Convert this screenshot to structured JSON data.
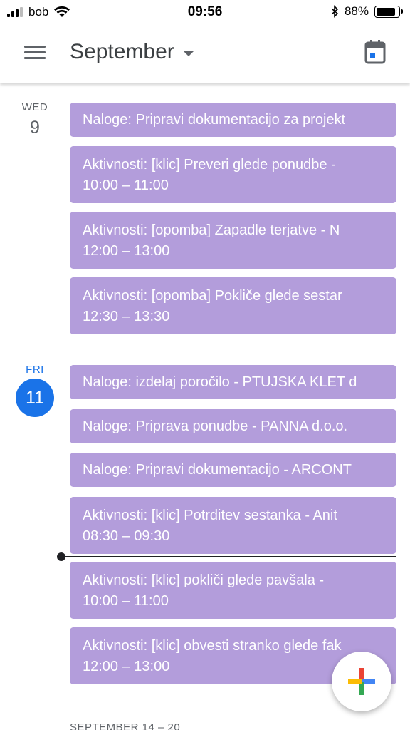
{
  "status_bar": {
    "carrier": "bob",
    "time": "09:56",
    "battery": "88%",
    "battery_level": 0.88,
    "icons": [
      "signal-icon",
      "wifi-icon",
      "bluetooth-icon",
      "battery-icon"
    ]
  },
  "header": {
    "month": "September",
    "menu_icon": "menu-icon",
    "dropdown_icon": "chevron-down-icon",
    "today_icon": "calendar-today-icon"
  },
  "colors": {
    "event": "#b39ddb",
    "today_accent": "#1a73e8",
    "text": "#3c4043"
  },
  "days": [
    {
      "dow": "WED",
      "date": "9",
      "events": [
        {
          "title": "Naloge: Pripravi dokumentacijo za projekt",
          "time": ""
        },
        {
          "title": "Aktivnosti: [klic] Preveri glede ponudbe -",
          "time": "10:00 – 11:00"
        },
        {
          "title": "Aktivnosti: [opomba] Zapadle terjatve - N",
          "time": "12:00 – 13:00"
        },
        {
          "title": "Aktivnosti: [opomba] Pokliče glede sestar",
          "time": "12:30 – 13:30"
        }
      ]
    },
    {
      "dow": "FRI",
      "date": "11",
      "events": [
        {
          "title": "Naloge: izdelaj poročilo - PTUJSKA KLET d",
          "time": ""
        },
        {
          "title": "Naloge: Priprava ponudbe - PANNA d.o.o.",
          "time": ""
        },
        {
          "title": "Naloge: Pripravi dokumentacijo - ARCONT",
          "time": ""
        },
        {
          "title": "Aktivnosti: [klic] Potrditev sestanka - Anit",
          "time": "08:30 – 09:30"
        },
        {
          "title": "Aktivnosti: [klic] pokliči glede pavšala -",
          "time": "10:00 – 11:00"
        },
        {
          "title": "Aktivnosti: [klic] obvesti stranko glede fak",
          "time": "12:00 – 13:00"
        }
      ]
    }
  ],
  "next_week_label": "SEPTEMBER 14 – 20",
  "fab": {
    "icon": "plus-icon"
  }
}
